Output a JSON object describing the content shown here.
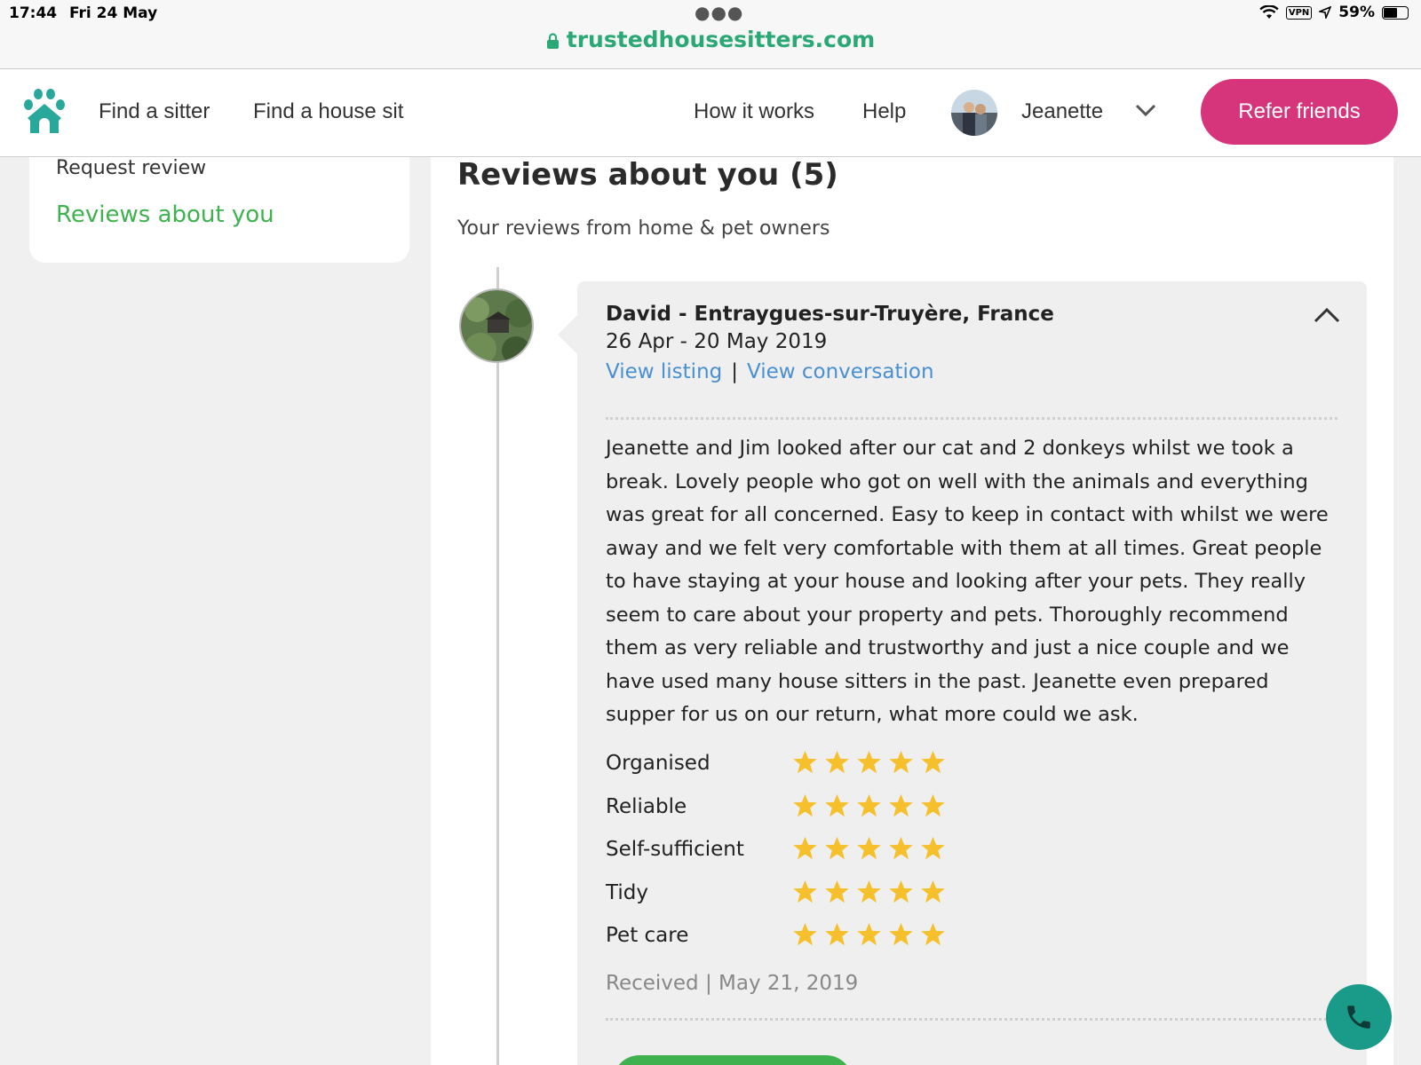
{
  "status_bar": {
    "time": "17:44",
    "date": "Fri 24 May",
    "vpn": "VPN",
    "battery": "59%"
  },
  "browser": {
    "url": "trustedhousesitters.com"
  },
  "header": {
    "nav": {
      "find_sitter": "Find a sitter",
      "find_house_sit": "Find a house sit",
      "how_it_works": "How it works",
      "help": "Help"
    },
    "user_name": "Jeanette",
    "refer_button": "Refer friends",
    "brand_color": "#d6357c",
    "logo_color": "#27a89a"
  },
  "sidebar": {
    "request_review": "Request review",
    "reviews_about_you": "Reviews about you",
    "active_color": "#3fb14f"
  },
  "main": {
    "title": "Reviews about you (5)",
    "subtitle": "Your reviews from home & pet owners"
  },
  "review": {
    "reviewer": "David - Entraygues-sur-Truyère, France",
    "dates": "26 Apr - 20 May 2019",
    "view_listing": "View listing",
    "separator": "|",
    "view_conversation": "View conversation",
    "text": "Jeanette and Jim looked after our cat and 2 donkeys whilst we took a break. Lovely people who got on well with the animals and everything was great for all concerned. Easy to keep in contact with whilst we were away and we felt very comfortable with them at all times. Great people to have staying at your house and looking after your pets. They really seem to care about your property and pets. Thoroughly recommend them as very reliable and trustworthy and just a nice couple and we have used many house sitters in the past. Jeanette even prepared supper for us on our return, what more could we ask.",
    "ratings": [
      {
        "label": "Organised",
        "stars": 5
      },
      {
        "label": "Reliable",
        "stars": 5
      },
      {
        "label": "Self-sufficient",
        "stars": 5
      },
      {
        "label": "Tidy",
        "stars": 5
      },
      {
        "label": "Pet care",
        "stars": 5
      }
    ],
    "received": "Received | May 21, 2019",
    "star_color": "#f6c02c",
    "link_color": "#4a8fd1"
  },
  "floating": {
    "call_icon": "phone-icon",
    "call_color": "#1a9b8a"
  }
}
